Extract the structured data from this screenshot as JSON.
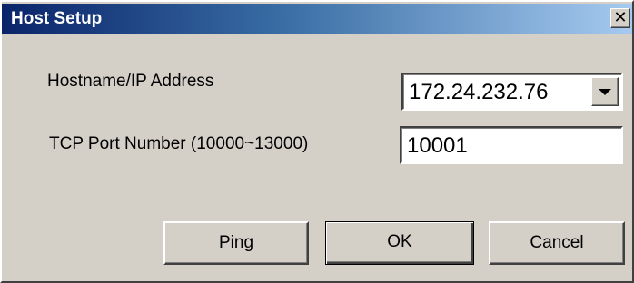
{
  "window": {
    "title": "Host Setup",
    "close_glyph": "✕",
    "close_icon": "close-icon"
  },
  "fields": {
    "host_label": "Hostname/IP Address",
    "host_value": "172.24.232.76",
    "port_label": "TCP Port Number (10000~13000)",
    "port_value": "10001"
  },
  "buttons": {
    "ping": "Ping",
    "ok": "OK",
    "cancel": "Cancel"
  },
  "colors": {
    "face": "#d4d0c8",
    "title_start": "#0a246a",
    "title_end": "#a6caf0"
  }
}
